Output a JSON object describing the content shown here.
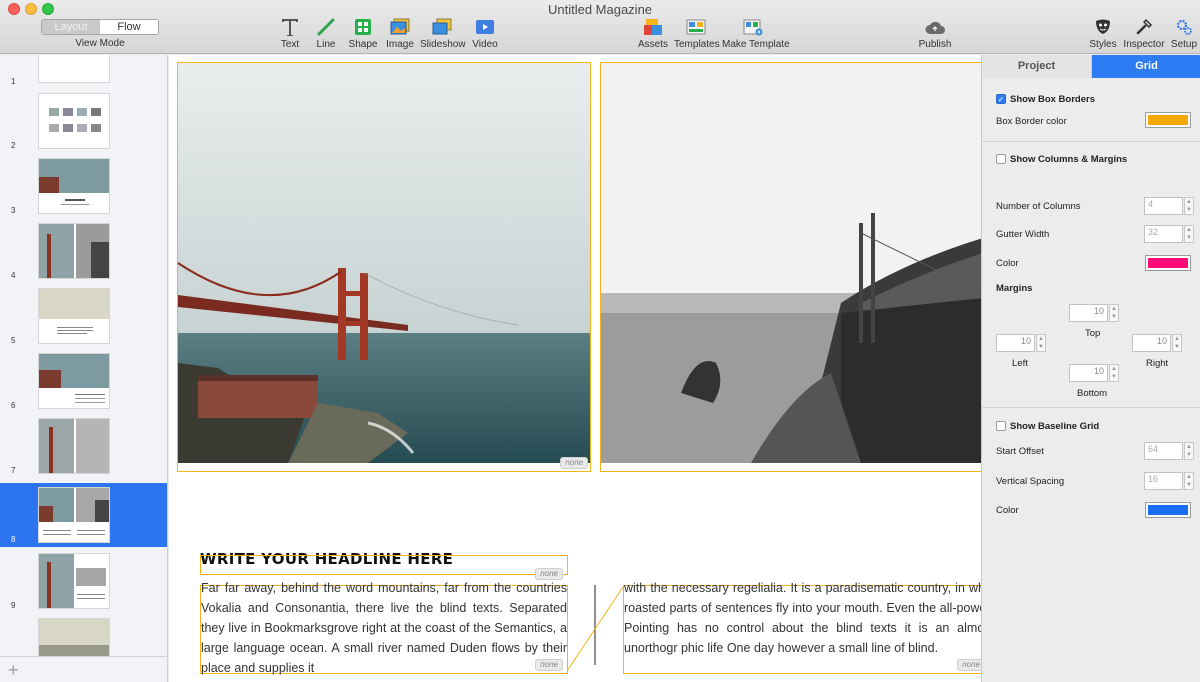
{
  "window": {
    "title": "Untitled Magazine"
  },
  "view_mode": {
    "options": [
      "Layout",
      "Flow"
    ],
    "selected": "Flow",
    "caption": "View Mode"
  },
  "toolbar": {
    "insert_tools": [
      {
        "label": "Text",
        "icon": "text-icon"
      },
      {
        "label": "Line",
        "icon": "line-icon"
      },
      {
        "label": "Shape",
        "icon": "shape-icon"
      },
      {
        "label": "Image",
        "icon": "image-icon"
      },
      {
        "label": "Slideshow",
        "icon": "slideshow-icon"
      },
      {
        "label": "Video",
        "icon": "video-icon"
      }
    ],
    "center_tools": [
      {
        "label": "Assets",
        "icon": "assets-icon"
      },
      {
        "label": "Templates",
        "icon": "templates-icon"
      },
      {
        "label": "Make Template",
        "icon": "make-template-icon"
      }
    ],
    "publish": {
      "label": "Publish",
      "icon": "cloud-publish-icon"
    },
    "right_tools": [
      {
        "label": "Styles",
        "icon": "styles-mask-icon"
      },
      {
        "label": "Inspector",
        "icon": "inspector-icon"
      },
      {
        "label": "Setup",
        "icon": "gears-icon"
      }
    ]
  },
  "sidebar": {
    "pages": [
      {
        "number": "1"
      },
      {
        "number": "2"
      },
      {
        "number": "3"
      },
      {
        "number": "4"
      },
      {
        "number": "5"
      },
      {
        "number": "6"
      },
      {
        "number": "7"
      },
      {
        "number": "8"
      },
      {
        "number": "9"
      },
      {
        "number": ""
      }
    ],
    "selected_page": "8",
    "add_label": "+"
  },
  "canvas": {
    "none_tag": "none",
    "headline": "WRITE YOUR HEADLINE HERE",
    "column1_text": "Far far away, behind the word mountains, far from the countries Vokalia and Consonantia, there live the blind texts. Separated they live in Bookmarksgrove right at the coast of the Semantics, a large language ocean. A small river named Duden flows by their place and supplies it",
    "column2_text": "with the necessary regelialia. It is a paradisematic country, in whic roasted parts of sentences fly into your mouth. Even the all-powerf Pointing has no control about the blind texts it is an almost unorthogr phic life One day however a small line of blind."
  },
  "inspector": {
    "tabs": [
      "Project",
      "Grid"
    ],
    "active_tab": "Grid",
    "show_box_borders": {
      "label": "Show Box Borders",
      "checked": true
    },
    "box_border_color": {
      "label": "Box Border color",
      "color": "#f5a800"
    },
    "show_columns_margins": {
      "label": "Show Columns & Margins",
      "checked": false
    },
    "number_of_columns": {
      "label": "Number of Columns",
      "value": "4"
    },
    "gutter_width": {
      "label": "Gutter Width",
      "value": "32"
    },
    "column_color": {
      "label": "Color",
      "color": "#ff0a78"
    },
    "margins": {
      "label": "Margins",
      "top": {
        "label": "Top",
        "value": "10"
      },
      "left": {
        "label": "Left",
        "value": "10"
      },
      "right": {
        "label": "Right",
        "value": "10"
      },
      "bottom": {
        "label": "Bottom",
        "value": "10"
      }
    },
    "show_baseline_grid": {
      "label": "Show Baseline Grid",
      "checked": false
    },
    "start_offset": {
      "label": "Start Offset",
      "value": "64"
    },
    "vertical_spacing": {
      "label": "Vertical Spacing",
      "value": "16"
    },
    "baseline_color": {
      "label": "Color",
      "color": "#1a6ef5"
    }
  }
}
